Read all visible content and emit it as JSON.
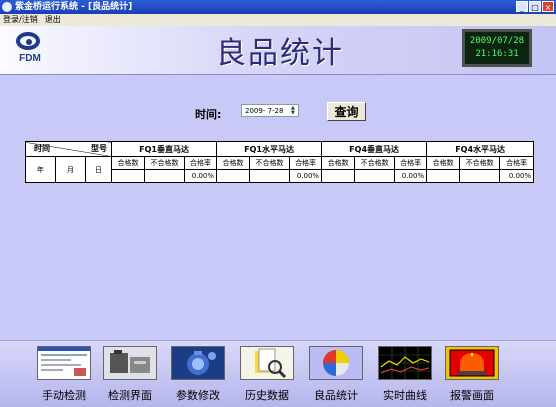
{
  "window": {
    "title": "紫金桥运行系统 - [良品统计]"
  },
  "menu": [
    "登录/注销",
    "退出"
  ],
  "header": {
    "logo_text": "FDM",
    "title": "良品统计",
    "clock_date": "2009/07/28",
    "clock_time": "21:16:31"
  },
  "query": {
    "label": "时间:",
    "date_value": "2009- 7-28",
    "button_label": "查询"
  },
  "table": {
    "corner_left": "时间",
    "corner_right": "型号",
    "groups": [
      "FQ1垂直马达",
      "FQ1水平马达",
      "FQ4垂直马达",
      "FQ4水平马达"
    ],
    "time_cols": [
      "年",
      "月",
      "日"
    ],
    "sub_cols": [
      "合格数",
      "不合格数",
      "合格率"
    ],
    "rates": [
      "0.00%",
      "0.00%",
      "0.00%",
      "0.00%"
    ]
  },
  "toolbar": [
    {
      "icon": "manual-check-icon",
      "label": "手动检测"
    },
    {
      "icon": "check-ui-icon",
      "label": "检测界面"
    },
    {
      "icon": "params-icon",
      "label": "参数修改"
    },
    {
      "icon": "history-icon",
      "label": "历史数据"
    },
    {
      "icon": "pie-chart-icon",
      "label": "良品统计"
    },
    {
      "icon": "realtime-curve-icon",
      "label": "实时曲线"
    },
    {
      "icon": "alarm-icon",
      "label": "报警画面"
    }
  ]
}
